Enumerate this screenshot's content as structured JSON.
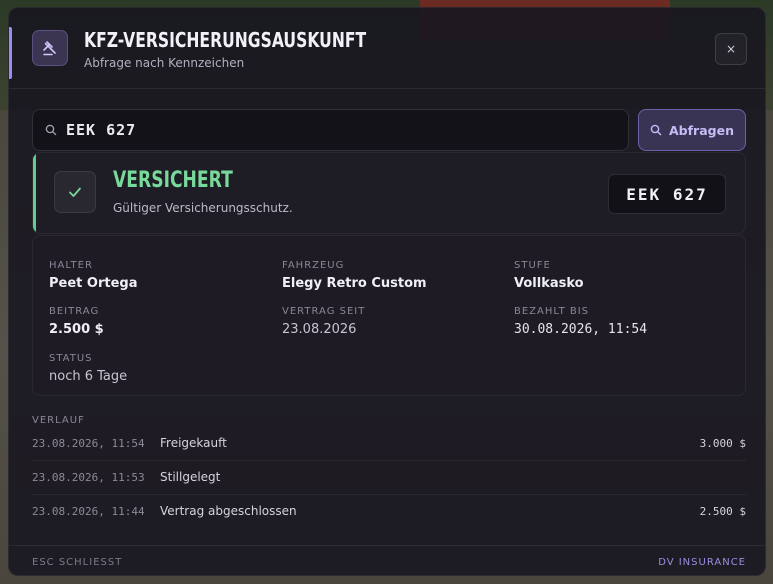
{
  "header": {
    "title": "KFZ-VERSICHERUNGSAUSKUNFT",
    "subtitle": "Abfrage nach Kennzeichen",
    "icon": "gavel-icon",
    "close_label": "×"
  },
  "search": {
    "value": "EEK 627",
    "icon": "search-icon",
    "button_label": "Abfragen"
  },
  "status": {
    "title": "VERSICHERT",
    "description": "Gültiger Versicherungsschutz.",
    "plate": "EEK 627",
    "icon": "check-icon",
    "color": "#78d99b"
  },
  "details": {
    "holder_label": "HALTER",
    "holder_value": "Peet Ortega",
    "vehicle_label": "FAHRZEUG",
    "vehicle_value": "Elegy Retro Custom",
    "tier_label": "STUFE",
    "tier_value": "Vollkasko",
    "premium_label": "BEITRAG",
    "premium_value": "2.500 $",
    "since_label": "VERTRAG SEIT",
    "since_value": "23.08.2026",
    "paid_label": "BEZAHLT BIS",
    "paid_value": "30.08.2026, 11:54",
    "status_label": "STATUS",
    "status_value": "noch 6 Tage"
  },
  "history": {
    "label": "VERLAUF",
    "rows": [
      {
        "date": "23.08.2026, 11:54",
        "event": "Freigekauft",
        "amount": "3.000 $"
      },
      {
        "date": "23.08.2026, 11:53",
        "event": "Stillgelegt",
        "amount": ""
      },
      {
        "date": "23.08.2026, 11:44",
        "event": "Vertrag abgeschlossen",
        "amount": "2.500 $"
      }
    ]
  },
  "footer": {
    "hint": "ESC SCHLIESST",
    "brand": "DV INSURANCE"
  },
  "colors": {
    "accent": "#9d8cf0",
    "success": "#5fd08c",
    "panel": "#181620"
  }
}
